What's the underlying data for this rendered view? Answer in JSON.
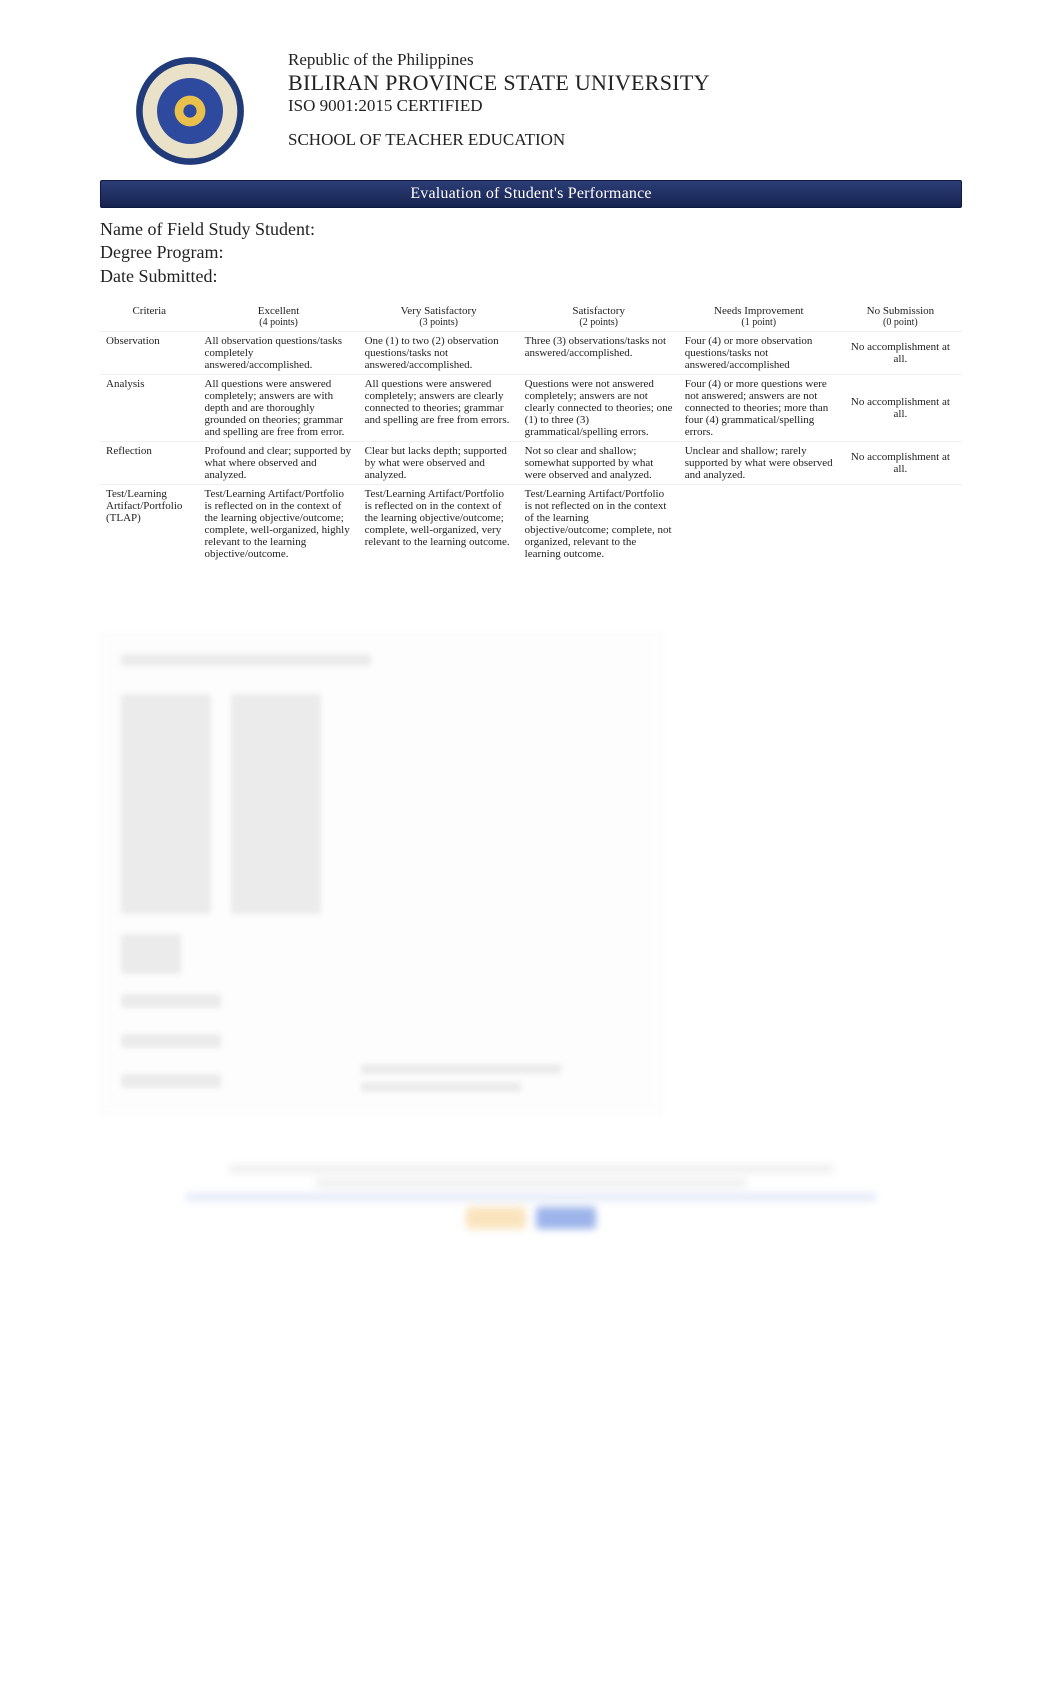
{
  "header": {
    "line1": "Republic of the Philippines",
    "line2": "BILIRAN PROVINCE STATE UNIVERSITY",
    "line3": "ISO 9001:2015 CERTIFIED",
    "line4": "SCHOOL OF TEACHER EDUCATION"
  },
  "section_bar": "Evaluation of Student's Performance",
  "meta": {
    "name_label": "Name of Field Study Student:",
    "degree_label": "Degree Program:",
    "date_label": "Date Submitted:"
  },
  "rubric": {
    "criteria_header": "Criteria",
    "levels": [
      {
        "name": "Excellent",
        "pts": "(4 points)"
      },
      {
        "name": "Very Satisfactory",
        "pts": "(3 points)"
      },
      {
        "name": "Satisfactory",
        "pts": "(2 points)"
      },
      {
        "name": "Needs Improvement",
        "pts": "(1 point)"
      },
      {
        "name": "No Submission",
        "pts": "(0 point)"
      }
    ],
    "no_submission_text": "No accomplishment at all.",
    "rows": [
      {
        "criterion": "Observation",
        "cells": [
          "All observation questions/tasks completely answered/accomplished.",
          "One (1) to two (2) observation questions/tasks not answered/accomplished.",
          "Three (3) observations/tasks not answered/accomplished.",
          "Four (4) or more observation questions/tasks not answered/accomplished"
        ]
      },
      {
        "criterion": "Analysis",
        "cells": [
          "All questions were answered completely; answers are with depth and are thoroughly grounded on theories; grammar and spelling are free from error.",
          "All questions were answered completely; answers are clearly connected to theories; grammar and spelling are free from errors.",
          "Questions were not answered completely; answers are not clearly connected to theories; one (1) to three (3) grammatical/spelling errors.",
          "Four (4) or more questions were not answered; answers are not connected to theories; more than four (4) grammatical/spelling errors."
        ]
      },
      {
        "criterion": "Reflection",
        "cells": [
          "Profound and clear; supported by what where observed and analyzed.",
          "Clear but lacks depth; supported by what were observed and analyzed.",
          "Not so clear and shallow; somewhat supported by what were observed and analyzed.",
          "Unclear and shallow; rarely supported by what were observed and analyzed."
        ]
      },
      {
        "criterion": "Test/Learning Artifact/Portfolio (TLAP)",
        "cells": [
          "Test/Learning Artifact/Portfolio is reflected on in the context of the learning objective/outcome; complete, well-organized, highly relevant to the learning objective/outcome.",
          "Test/Learning Artifact/Portfolio is reflected on in the context of the learning objective/outcome; complete, well-organized, very relevant to the learning outcome.",
          "Test/Learning Artifact/Portfolio is not reflected on in the context of the learning objective/outcome; complete, not organized, relevant to the learning outcome.",
          ""
        ]
      }
    ]
  }
}
